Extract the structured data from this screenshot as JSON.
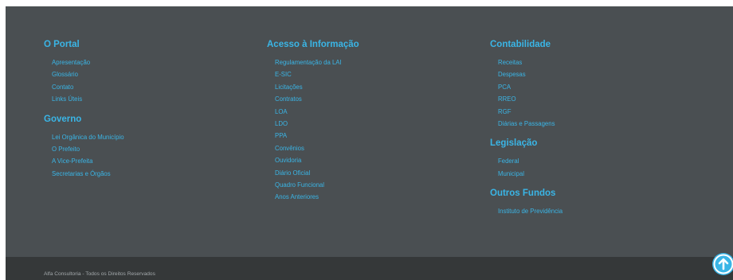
{
  "footer": {
    "columns": [
      {
        "sections": [
          {
            "title": "O Portal",
            "links": [
              "Apresentação",
              "Glossário",
              "Contato",
              "Links Úteis"
            ]
          },
          {
            "title": "Governo",
            "links": [
              "Lei Orgânica do Município",
              "O Prefeito",
              "A Vice-Prefeita",
              "Secretarias e Órgãos"
            ]
          }
        ]
      },
      {
        "sections": [
          {
            "title": "Acesso à Informação",
            "links": [
              "Regulamentação da LAI",
              "E-SIC",
              "Licitações",
              "Contratos",
              "LOA",
              "LDO",
              "PPA",
              "Convênios",
              "Ouvidoria",
              "Diário Oficial",
              "Quadro Funcional",
              "Anos Anteriores"
            ]
          }
        ]
      },
      {
        "sections": [
          {
            "title": "Contabilidade",
            "links": [
              "Receitas",
              "Despesas",
              "PCA",
              "RREO",
              "RGF",
              "Diárias e Passagens"
            ]
          },
          {
            "title": "Legislação",
            "links": [
              "Federal",
              "Municipal"
            ]
          },
          {
            "title": "Outros Fundos",
            "links": [
              "Instituto de Previdência"
            ]
          }
        ]
      }
    ],
    "copyright": "Alfa Consultoria - Todos os Direitos Reservados",
    "back_to_top_icon": "arrow-up-circle-icon"
  },
  "colors": {
    "footer_bg": "#4a4f52",
    "bottom_bar_bg": "#353839",
    "accent": "#3ab5e6",
    "muted_text": "#a3a8ab"
  }
}
